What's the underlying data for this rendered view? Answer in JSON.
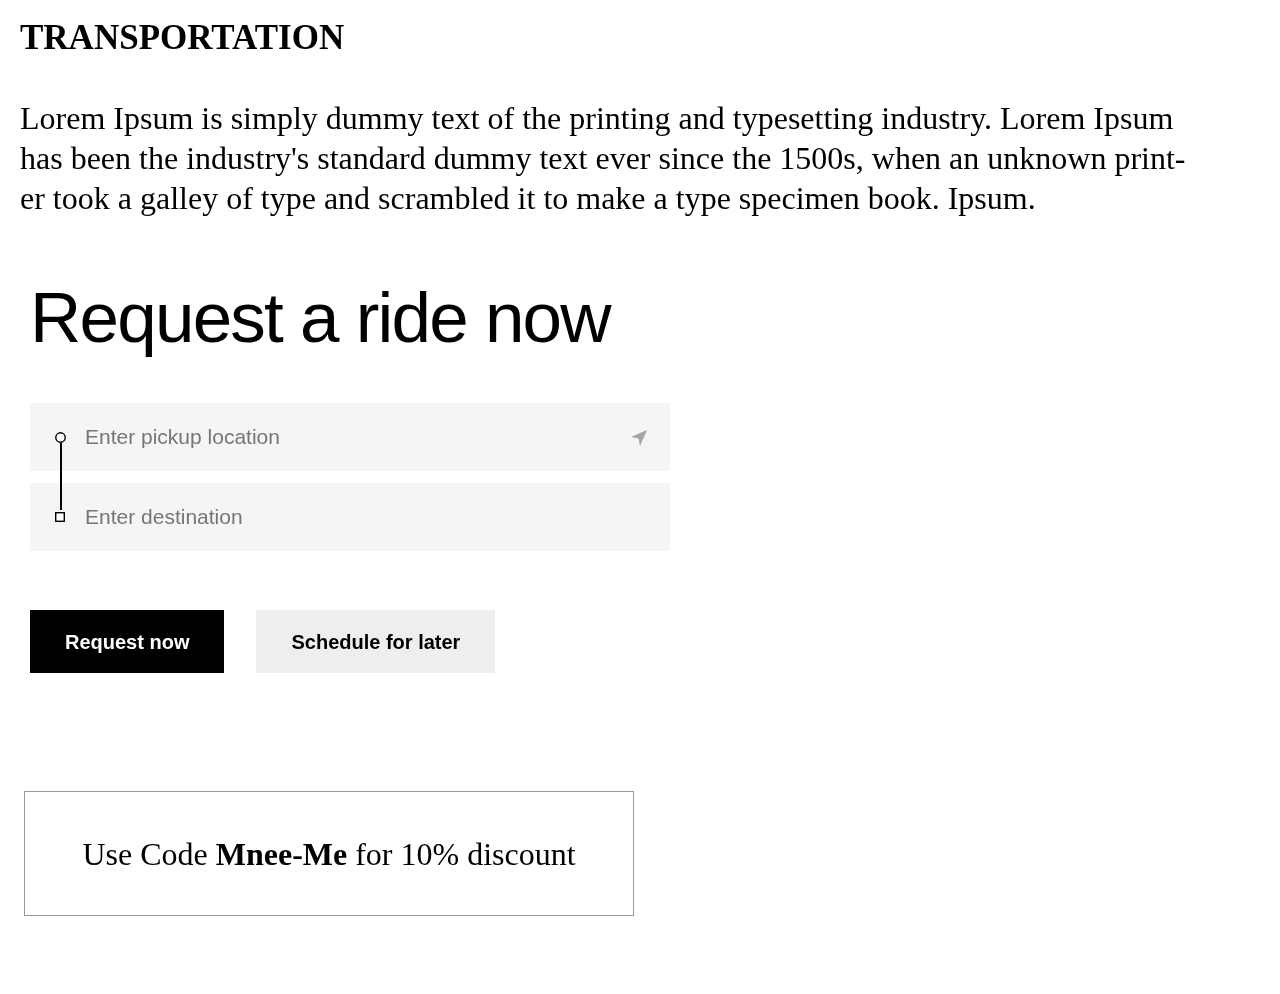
{
  "heading": "TRANSPORTATION",
  "intro": {
    "lines": [
      "Lorem Ipsum is simply dummy text of the printing and typesetting industry. Lorem Ipsum",
      "has been the industry's standard dummy text ever since the 1500s, when an unknown print-",
      "er took a galley of type and scrambled it to make a type specimen book. Ipsum."
    ]
  },
  "ride_form": {
    "title": "Request a ride now",
    "fields": [
      {
        "kind": "pickup",
        "placeholder": "Enter pickup location"
      },
      {
        "kind": "destination",
        "placeholder": "Enter destination"
      }
    ],
    "buttons": [
      {
        "kind": "primary",
        "label": "Request now"
      },
      {
        "kind": "secondary",
        "label": "Schedule for later"
      }
    ]
  },
  "promo": {
    "text": "Use Code **Mnee-Me** for 10% discount"
  }
}
